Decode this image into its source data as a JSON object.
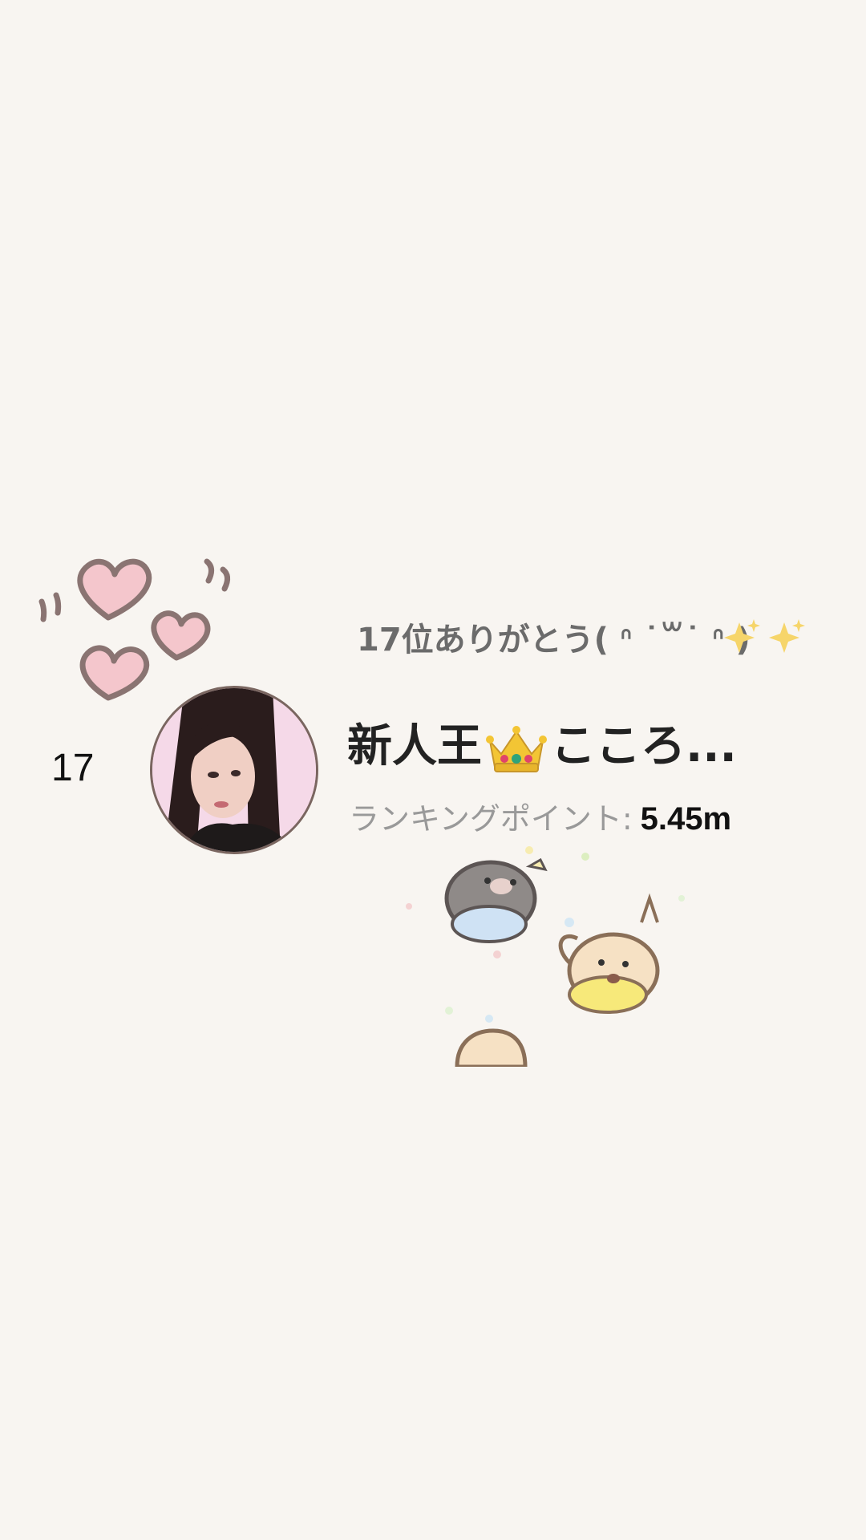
{
  "message": {
    "text": "17位ありがとう( ᐢ ˙꒳​˙ ᐢ )"
  },
  "entry": {
    "rank": "17",
    "name_prefix": "新人王",
    "name_suffix": "こころ...",
    "points_label": "ランキングポイント:",
    "points_value": "5.45m"
  },
  "icons": {
    "decor_hearts": "hearts-icon",
    "decor_sparkles": "sparkles-icon",
    "crown": "crown-icon",
    "avatar": "user-avatar",
    "stickers": "animal-stickers"
  },
  "colors": {
    "background": "#f8f5f1",
    "heart_fill": "#f4c6cc",
    "heart_outline": "#8a7472",
    "avatar_border": "#7a6660"
  }
}
